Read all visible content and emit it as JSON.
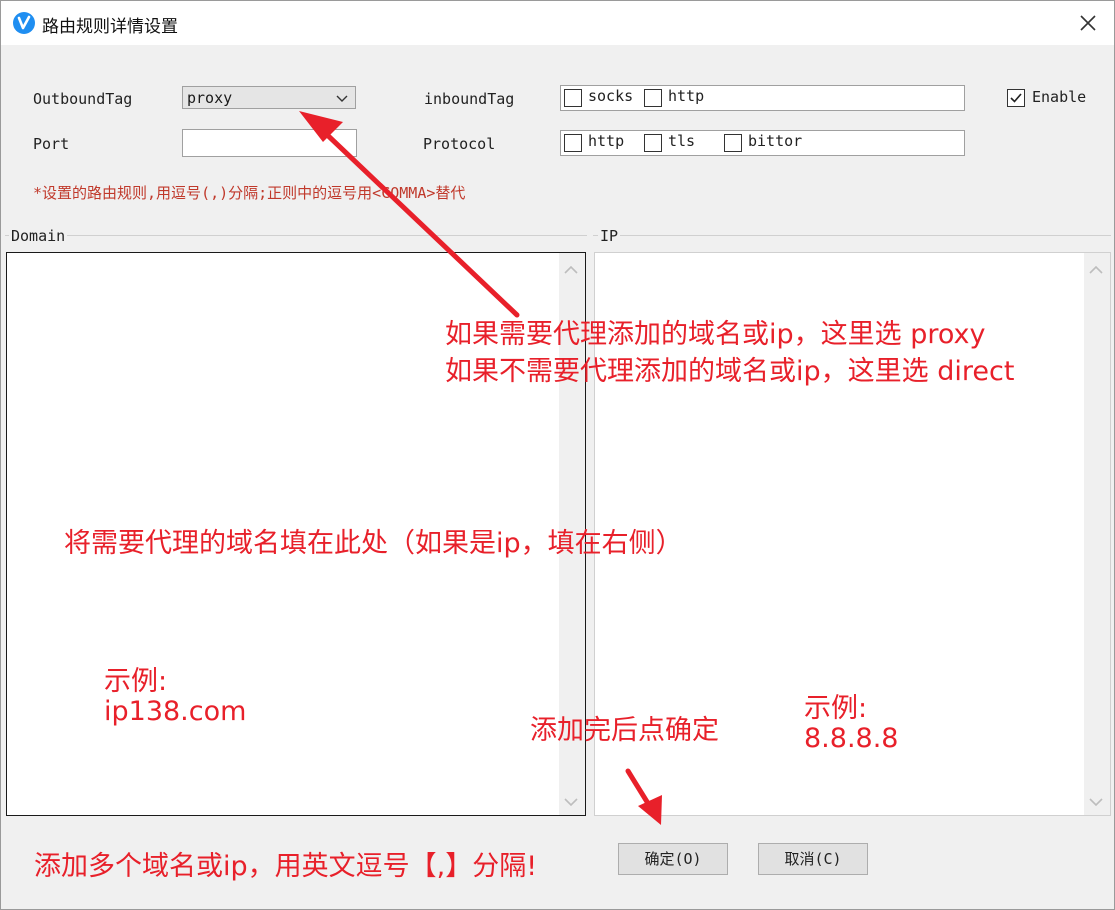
{
  "window": {
    "title": "路由规则详情设置"
  },
  "form": {
    "outbound_label": "OutboundTag",
    "outbound_value": "proxy",
    "port_label": "Port",
    "port_value": "",
    "inbound_label": "inboundTag",
    "inbound_options": [
      {
        "label": "socks",
        "checked": false
      },
      {
        "label": "http",
        "checked": false
      }
    ],
    "protocol_label": "Protocol",
    "protocol_options": [
      {
        "label": "http",
        "checked": false
      },
      {
        "label": "tls",
        "checked": false
      },
      {
        "label": "bittor",
        "checked": false
      }
    ],
    "enable_label": "Enable",
    "enable_checked": true,
    "hint": "*设置的路由规则,用逗号(,)分隔;正则中的逗号用<COMMA>替代"
  },
  "domain_group": {
    "label": "Domain",
    "value": ""
  },
  "ip_group": {
    "label": "IP",
    "value": ""
  },
  "buttons": {
    "ok": "确定(O)",
    "cancel": "取消(C)"
  },
  "annotations": {
    "proxy_line1": "如果需要代理添加的域名或ip，这里选 proxy",
    "proxy_line2": "如果不需要代理添加的域名或ip，这里选 direct",
    "domain_fill": "将需要代理的域名填在此处（如果是ip，填在右侧）",
    "domain_example_label": "示例:",
    "domain_example_value": "ip138.com",
    "ip_example_label": "示例:",
    "ip_example_value": "8.8.8.8",
    "confirm_hint": "添加完后点确定",
    "multi_hint": "添加多个域名或ip，用英文逗号【,】分隔!"
  },
  "colors": {
    "annotation": "#e8202a",
    "hint": "#c0392b",
    "app_icon": "#1f8ef1"
  }
}
